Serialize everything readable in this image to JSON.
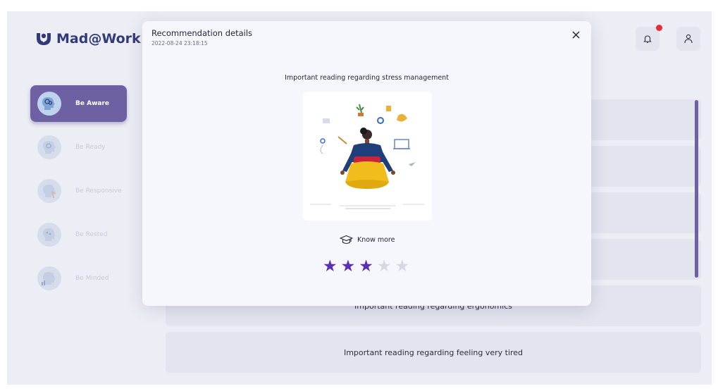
{
  "app": {
    "name": "Mad@Work"
  },
  "sidebar": {
    "items": [
      {
        "label": "Be Aware",
        "icon": "head-gears-icon",
        "active": true
      },
      {
        "label": "Be Ready",
        "icon": "head-target-icon",
        "active": false
      },
      {
        "label": "Be Responsive",
        "icon": "head-person-icon",
        "active": false
      },
      {
        "label": "Be Rested",
        "icon": "head-stars-icon",
        "active": false
      },
      {
        "label": "Be Minded",
        "icon": "head-chart-icon",
        "active": false
      }
    ]
  },
  "list": {
    "items": [
      {
        "title": ""
      },
      {
        "title": ""
      },
      {
        "title": ""
      },
      {
        "title": ""
      },
      {
        "title": "Important reading regarding ergonomics"
      },
      {
        "title": "Important reading regarding feeling very tired"
      }
    ]
  },
  "modal": {
    "title": "Recommendation details",
    "date": "2022-08-24 23:18:15",
    "subtitle": "Important reading regarding stress management",
    "know_more": "Know more",
    "rating": 3,
    "rating_max": 5
  },
  "colors": {
    "accent": "#6e61a3",
    "star_active": "#5a2fb3",
    "star_inactive": "#d5d7e3",
    "notification_dot": "#e52b3c",
    "logo": "#343a79"
  }
}
